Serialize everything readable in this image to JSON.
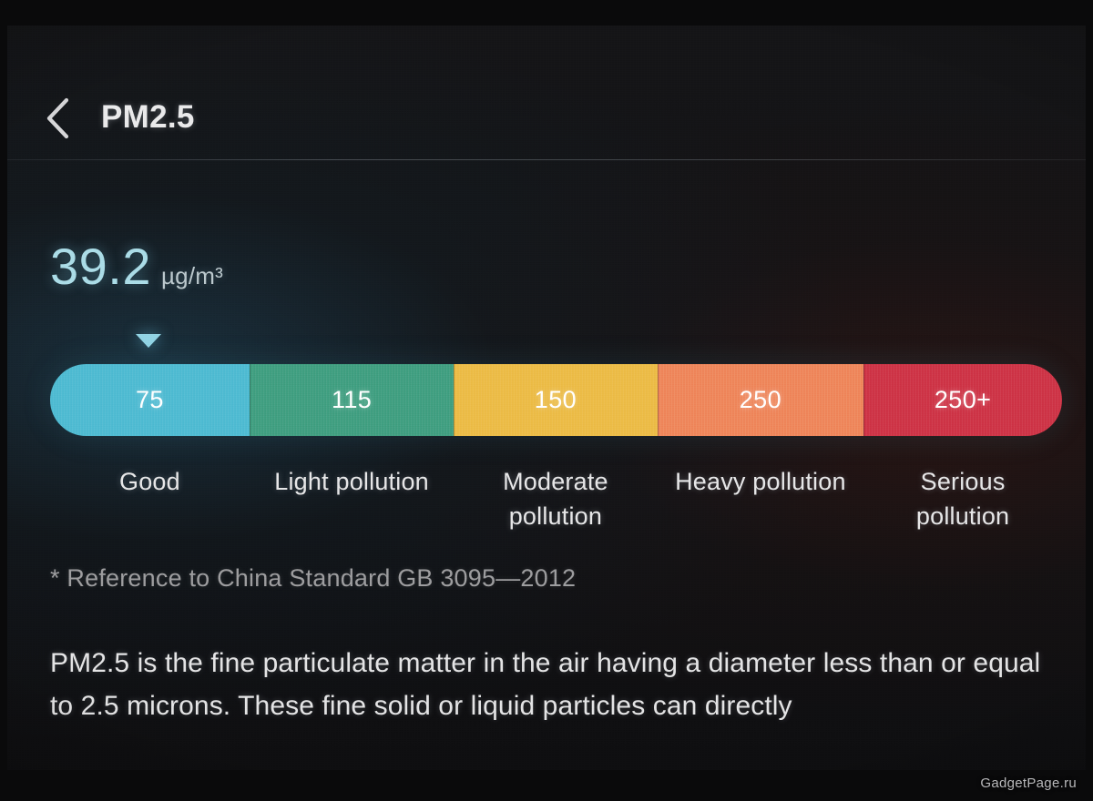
{
  "header": {
    "back_icon": "chevron-left-icon",
    "title": "PM2.5"
  },
  "reading": {
    "value": "39.2",
    "unit": "µg/m³",
    "marker_icon": "triangle-down-marker",
    "value_color": "#a8dbe6"
  },
  "scale": {
    "segments": [
      {
        "threshold": "75",
        "caption": "Good",
        "color": "#4bb8d0",
        "width_pct": 19.7
      },
      {
        "threshold": "115",
        "caption": "Light pollution",
        "color": "#3d9b7c",
        "width_pct": 20.2
      },
      {
        "threshold": "150",
        "caption": "Moderate pollution",
        "color": "#ebb943",
        "width_pct": 20.1
      },
      {
        "threshold": "250",
        "caption": "Heavy pollution",
        "color": "#ee8257",
        "width_pct": 20.4
      },
      {
        "threshold": "250+",
        "caption": "Serious pollution",
        "color": "#cc3143",
        "width_pct": 19.6
      }
    ]
  },
  "footnote": "* Reference to China Standard GB 3095—2012",
  "description": "PM2.5 is the fine particulate matter in the air having a diameter less than or equal to 2.5 microns. These fine solid or liquid particles can directly",
  "watermark": "GadgetPage.ru"
}
